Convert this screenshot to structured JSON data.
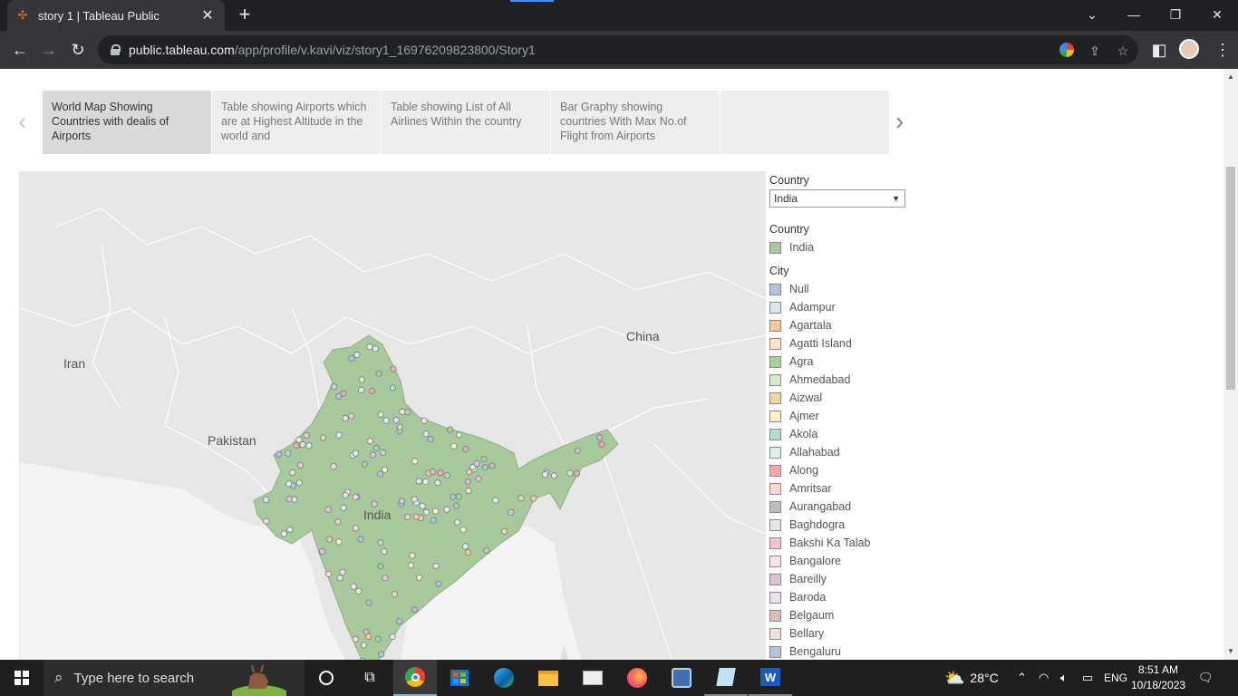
{
  "browser": {
    "tab_title": "story 1 | Tableau Public",
    "new_tab": "+",
    "url_host": "public.tableau.com",
    "url_path": "/app/profile/v.kavi/viz/story1_16976209823800/Story1"
  },
  "story": {
    "points": [
      {
        "label": "World Map Showing Countries with dealis of Airports"
      },
      {
        "label": "Table showing Airports which are at Highest Altitude in the world and"
      },
      {
        "label": "Table showing List of All Airlines Within the country"
      },
      {
        "label": "Bar Graphy showing countries With Max No.of Flight from Airports"
      },
      {
        "label": ""
      }
    ]
  },
  "map": {
    "labels": {
      "iran": "Iran",
      "pakistan": "Pakistan",
      "china": "China",
      "india": "India"
    },
    "colors": {
      "land": "#e7e7e7",
      "sea": "#f2f2f2",
      "india_fill": "#a8c99b",
      "border": "#ffffff"
    }
  },
  "filter": {
    "title": "Country",
    "selected": "India"
  },
  "country_legend": {
    "title": "Country",
    "items": [
      {
        "label": "India",
        "color": "#a8c99b"
      }
    ]
  },
  "city_legend": {
    "title": "City",
    "items": [
      {
        "label": "Null",
        "color": "#b3c4dc"
      },
      {
        "label": "Adampur",
        "color": "#d9e8f5"
      },
      {
        "label": "Agartala",
        "color": "#f7c89a"
      },
      {
        "label": "Agatti Island",
        "color": "#fde3c8"
      },
      {
        "label": "Agra",
        "color": "#a9cf9c"
      },
      {
        "label": "Ahmedabad",
        "color": "#d4ecc8"
      },
      {
        "label": "Aizwal",
        "color": "#e8d8a8"
      },
      {
        "label": "Ajmer",
        "color": "#fdf0c8"
      },
      {
        "label": "Akola",
        "color": "#b9d9d2"
      },
      {
        "label": "Allahabad",
        "color": "#dcefec"
      },
      {
        "label": "Along",
        "color": "#f3a9a9"
      },
      {
        "label": "Amritsar",
        "color": "#fcd7d3"
      },
      {
        "label": "Aurangabad",
        "color": "#bdbdbd"
      },
      {
        "label": "Baghdogra",
        "color": "#e6e6e3"
      },
      {
        "label": "Bakshi Ka Talab",
        "color": "#f3c5d3"
      },
      {
        "label": "Bangalore",
        "color": "#fde2e9"
      },
      {
        "label": "Bareilly",
        "color": "#dcc3da"
      },
      {
        "label": "Baroda",
        "color": "#efdcee"
      },
      {
        "label": "Belgaum",
        "color": "#d3c1b5"
      },
      {
        "label": "Bellary",
        "color": "#ede2db"
      },
      {
        "label": "Bengaluru",
        "color": "#b3c4dc"
      }
    ]
  },
  "taskbar": {
    "search_placeholder": "Type here to search",
    "temperature": "28°C",
    "language": "ENG",
    "time": "8:51 AM",
    "date": "10/18/2023"
  }
}
